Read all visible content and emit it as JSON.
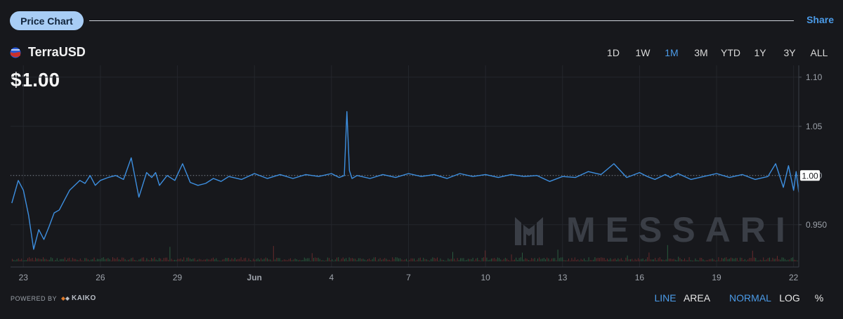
{
  "header": {
    "pill_label": "Price Chart",
    "share_label": "Share"
  },
  "asset": {
    "name": "TerraUSD",
    "price": "$1.00"
  },
  "time_ranges": [
    {
      "label": "1D",
      "active": false
    },
    {
      "label": "1W",
      "active": false
    },
    {
      "label": "1M",
      "active": true
    },
    {
      "label": "3M",
      "active": false
    },
    {
      "label": "YTD",
      "active": false
    },
    {
      "label": "1Y",
      "active": false
    },
    {
      "label": "3Y",
      "active": false
    },
    {
      "label": "ALL",
      "active": false
    }
  ],
  "footer": {
    "powered_by": "POWERED BY",
    "provider": "KAIKO",
    "chart_types": [
      {
        "label": "LINE",
        "active": true
      },
      {
        "label": "AREA",
        "active": false
      }
    ],
    "scales": [
      {
        "label": "NORMAL",
        "active": true
      },
      {
        "label": "LOG",
        "active": false
      },
      {
        "label": "%",
        "active": false
      }
    ]
  },
  "watermark": "MESSARI",
  "colors": {
    "line": "#3d8fe0",
    "accent": "#4b9be8",
    "volume_up": "#2e6b47",
    "volume_down": "#7a2f2f",
    "background": "#17181c"
  },
  "chart_data": {
    "type": "line",
    "title": "",
    "x_tick_labels": [
      "23",
      "26",
      "29",
      "Jun",
      "4",
      "7",
      "10",
      "13",
      "16",
      "19",
      "22"
    ],
    "x_tick_days": [
      1,
      4,
      7,
      10,
      13,
      16,
      19,
      22,
      25,
      28,
      31
    ],
    "x_range_days": [
      0.5,
      31.2
    ],
    "y_tick_labels": [
      "1.10",
      "1.05",
      "1.00",
      "0.950"
    ],
    "y_ticks": [
      1.1,
      1.05,
      1.0,
      0.95
    ],
    "ylim": [
      0.907,
      1.112
    ],
    "current_value": 1.0,
    "current_value_label": "1.00",
    "grid": true,
    "volume_bars": true,
    "series": [
      {
        "x": [
          0.55,
          0.8,
          1.0,
          1.2,
          1.4,
          1.6,
          1.8,
          2.0,
          2.2,
          2.4,
          2.6,
          2.8,
          3.0,
          3.2,
          3.4,
          3.6,
          3.8,
          4.0,
          4.3,
          4.6,
          4.9,
          5.2,
          5.5,
          5.8,
          6.0,
          6.15,
          6.3,
          6.6,
          6.9,
          7.2,
          7.5,
          7.8,
          8.1,
          8.4,
          8.7,
          9.0,
          9.5,
          10.0,
          10.5,
          11.0,
          11.5,
          12.0,
          12.5,
          13.0,
          13.3,
          13.5,
          13.6,
          13.7,
          13.8,
          14.0,
          14.5,
          15.0,
          15.5,
          16.0,
          16.5,
          17.0,
          17.5,
          18.0,
          18.5,
          19.0,
          19.5,
          20.0,
          20.5,
          21.0,
          21.5,
          22.0,
          22.5,
          23.0,
          23.5,
          24.0,
          24.5,
          25.0,
          25.3,
          25.6,
          26.0,
          26.2,
          26.5,
          27.0,
          27.5,
          28.0,
          28.5,
          29.0,
          29.5,
          30.0,
          30.3,
          30.6,
          30.8,
          31.0,
          31.1,
          31.2
        ],
        "y": [
          0.972,
          0.995,
          0.985,
          0.96,
          0.925,
          0.945,
          0.935,
          0.948,
          0.962,
          0.965,
          0.975,
          0.985,
          0.99,
          0.995,
          0.992,
          1.0,
          0.99,
          0.995,
          0.998,
          1.0,
          0.996,
          1.018,
          0.978,
          1.003,
          0.998,
          1.003,
          0.99,
          1.0,
          0.995,
          1.012,
          0.993,
          0.99,
          0.992,
          0.997,
          0.994,
          0.999,
          0.996,
          1.002,
          0.997,
          1.001,
          0.997,
          1.001,
          0.999,
          1.002,
          0.998,
          1.0,
          1.065,
          1.005,
          0.997,
          1.0,
          0.997,
          1.001,
          0.998,
          1.002,
          0.999,
          1.001,
          0.997,
          1.002,
          0.999,
          1.001,
          0.998,
          1.001,
          0.999,
          1.0,
          0.994,
          0.999,
          0.998,
          1.004,
          1.001,
          1.012,
          0.998,
          1.003,
          0.999,
          0.996,
          1.001,
          0.998,
          1.002,
          0.996,
          0.999,
          1.002,
          0.998,
          1.001,
          0.996,
          0.999,
          1.012,
          0.988,
          1.01,
          0.985,
          1.004,
          0.983
        ]
      }
    ]
  }
}
